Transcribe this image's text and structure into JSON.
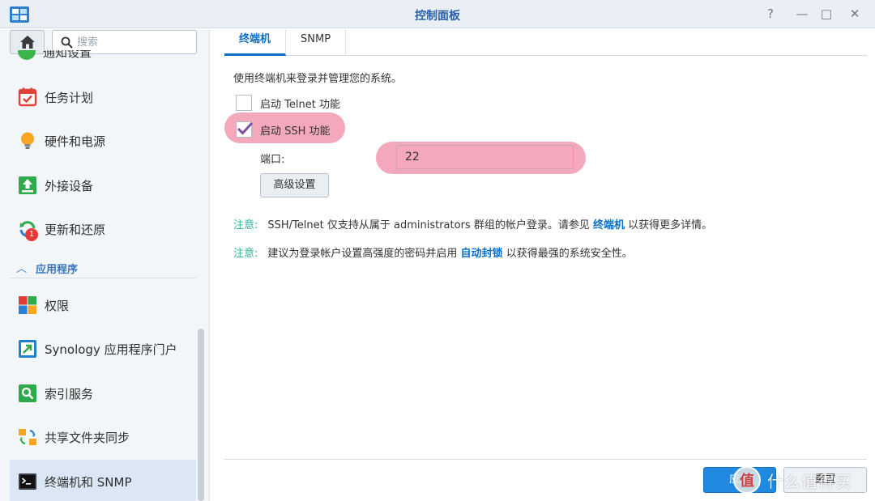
{
  "window": {
    "title": "控制面板",
    "controls": [
      "?",
      "—",
      "□",
      "✕"
    ]
  },
  "sidebar": {
    "search": {
      "placeholder": "搜索",
      "value": ""
    },
    "cut_item_label": "通知设置",
    "items": [
      {
        "label": "任务计划",
        "icon": "calendar-check-icon"
      },
      {
        "label": "硬件和电源",
        "icon": "lightbulb-icon"
      },
      {
        "label": "外接设备",
        "icon": "upload-device-icon"
      },
      {
        "label": "更新和还原",
        "icon": "refresh-icon",
        "badge": "1"
      },
      {
        "label": "权限",
        "icon": "permission-grid-icon"
      },
      {
        "label": "Synology 应用程序门户",
        "icon": "app-portal-icon"
      },
      {
        "label": "索引服务",
        "icon": "index-search-icon"
      },
      {
        "label": "共享文件夹同步",
        "icon": "folder-sync-icon"
      },
      {
        "label": "终端机和 SNMP",
        "icon": "terminal-icon",
        "active": true
      }
    ],
    "section": {
      "label": "应用程序"
    }
  },
  "tabs": [
    {
      "label": "终端机",
      "active": true
    },
    {
      "label": "SNMP",
      "active": false
    }
  ],
  "content": {
    "description": "使用终端机来登录并管理您的系统。",
    "telnet": {
      "label": "启动 Telnet 功能",
      "checked": false
    },
    "ssh": {
      "label": "启动 SSH 功能",
      "checked": true
    },
    "port": {
      "label": "端口:",
      "value": "22"
    },
    "advanced_button": "高级设置",
    "note1": {
      "tag": "注意:",
      "text_before": "SSH/Telnet 仅支持从属于 administrators 群组的帐户登录。请参见",
      "link": "终端机",
      "text_after": "以获得更多详情。"
    },
    "note2": {
      "tag": "注意:",
      "text_before": "建议为登录帐户设置高强度的密码并启用",
      "link": "自动封锁",
      "text_after": "以获得最强的系统安全性。"
    }
  },
  "footer": {
    "apply_label": "应用",
    "reset_label": "重置"
  },
  "watermark": {
    "logo_char": "值",
    "text": "什么值得买"
  },
  "colors": {
    "accent": "#0b6fc8",
    "note": "#2eb39b",
    "highlight": "#f3a9bb",
    "checkmark": "#7a4fa3"
  }
}
